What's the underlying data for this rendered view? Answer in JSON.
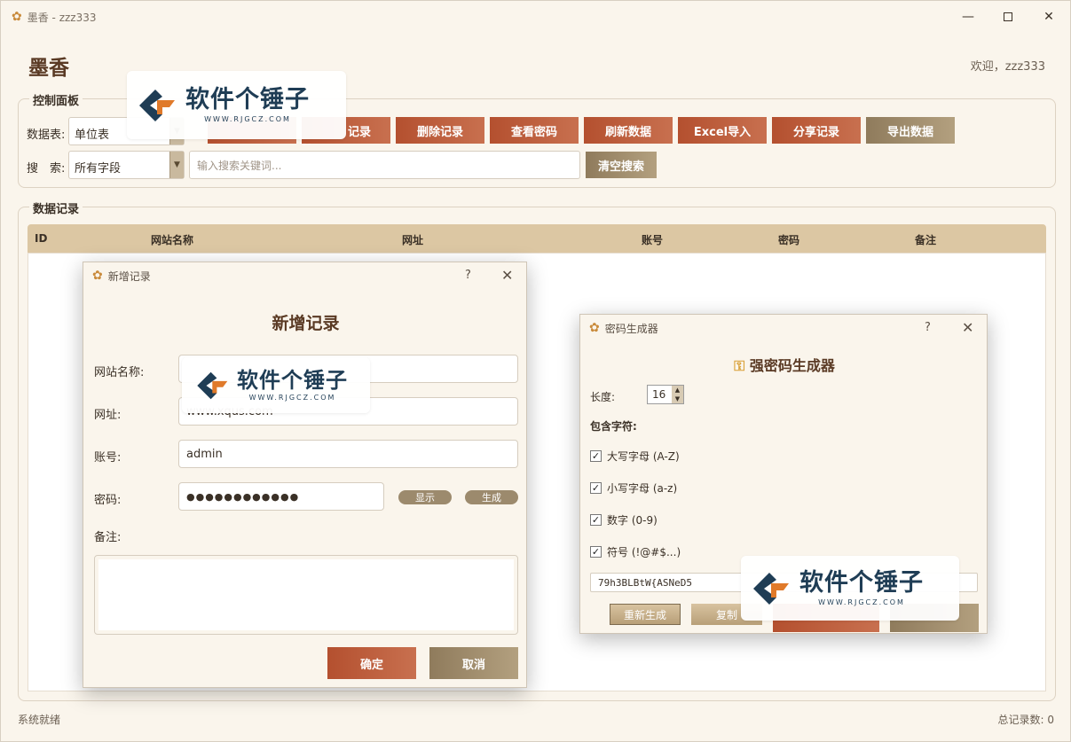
{
  "window": {
    "title": "墨香 - zzz333"
  },
  "app": {
    "title": "墨香",
    "welcome": "欢迎，zzz333"
  },
  "control_panel": {
    "title": "控制面板",
    "table_label": "数据表:",
    "table_value": "单位表",
    "search_label": "搜　索:",
    "search_field_value": "所有字段",
    "search_placeholder": "输入搜索关键词...",
    "clear_search": "清空搜索",
    "buttons": [
      "记录",
      "删除记录",
      "查看密码",
      "刷新数据",
      "Excel导入",
      "分享记录",
      "导出数据"
    ]
  },
  "records": {
    "title": "数据记录",
    "columns": [
      "ID",
      "网站名称",
      "网址",
      "账号",
      "密码",
      "备注"
    ]
  },
  "status": {
    "left": "系统就绪",
    "right": "总记录数: 0"
  },
  "add_dialog": {
    "window_title": "新增记录",
    "heading": "新增记录",
    "help": "?",
    "labels": {
      "site": "网站名称:",
      "url": "网址:",
      "account": "账号:",
      "password": "密码:",
      "note": "备注:"
    },
    "values": {
      "url": "www.xqus.com",
      "account": "admin",
      "password": "●●●●●●●●●●●●"
    },
    "show": "显示",
    "generate": "生成",
    "ok": "确定",
    "cancel": "取消"
  },
  "pwd_dialog": {
    "window_title": "密码生成器",
    "heading": "强密码生成器",
    "help": "?",
    "length_label": "长度:",
    "length_value": "16",
    "include_label": "包含字符:",
    "options": [
      "大写字母 (A-Z)",
      "小写字母 (a-z)",
      "数字 (0-9)",
      "符号 (!@#$...)"
    ],
    "result": "79h3BLBtW{ASNeD5",
    "regenerate": "重新生成",
    "copy": "复制"
  },
  "watermark": {
    "text": "软件个锤子",
    "sub": "WWW.RJGCZ.COM"
  },
  "colors": {
    "accent_red": "#b4502f",
    "accent_tan": "#9c8a6d",
    "header_bg": "#dcc7a3",
    "title_brown": "#5a3a24"
  }
}
